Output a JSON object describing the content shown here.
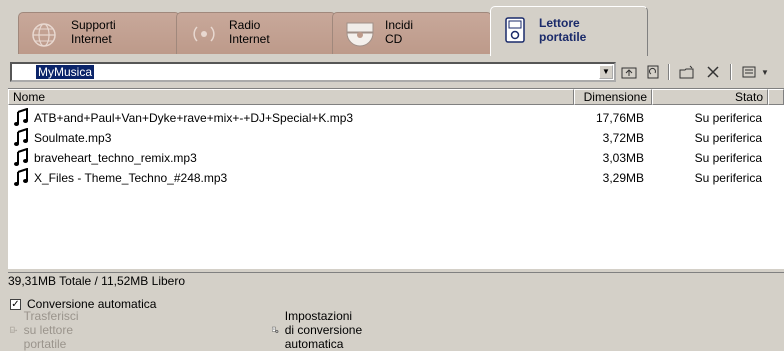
{
  "tabs": [
    {
      "line1": "Supporti",
      "line2": "Internet",
      "icon": "globe-icon"
    },
    {
      "line1": "Radio",
      "line2": "Internet",
      "icon": "radio-icon"
    },
    {
      "line1": "Incidi",
      "line2": "CD",
      "icon": "cd-icon"
    },
    {
      "line1": "Lettore",
      "line2": "portatile",
      "icon": "portable-player-icon"
    }
  ],
  "address": {
    "value": "MyMusica"
  },
  "toolbar": {
    "icons": [
      "folder-up-icon",
      "refresh-icon",
      "new-folder-icon",
      "delete-icon",
      "view-menu-icon"
    ]
  },
  "list": {
    "columns": {
      "name": "Nome",
      "size": "Dimensione",
      "status": "Stato"
    },
    "rows": [
      {
        "name": "ATB+and+Paul+Van+Dyke+rave+mix+-+DJ+Special+K.mp3",
        "size": "17,76MB",
        "status": "Su periferica"
      },
      {
        "name": "Soulmate.mp3",
        "size": "3,72MB",
        "status": "Su periferica"
      },
      {
        "name": "braveheart_techno_remix.mp3",
        "size": "3,03MB",
        "status": "Su periferica"
      },
      {
        "name": "X_Files - Theme_Techno_#248.mp3",
        "size": "3,29MB",
        "status": "Su periferica"
      }
    ]
  },
  "status": {
    "text": "39,31MB Totale / 11,52MB Libero"
  },
  "options": {
    "auto_convert_label": "Conversione automatica",
    "auto_convert_checked": true
  },
  "actions": {
    "transfer_label": "Trasferisci su lettore portatile",
    "settings_label": "Impostazioni di conversione automatica"
  },
  "colors": {
    "tab_inactive": "#c8a89a",
    "selection": "#0a246a",
    "window_bg": "#d4d0c8"
  }
}
